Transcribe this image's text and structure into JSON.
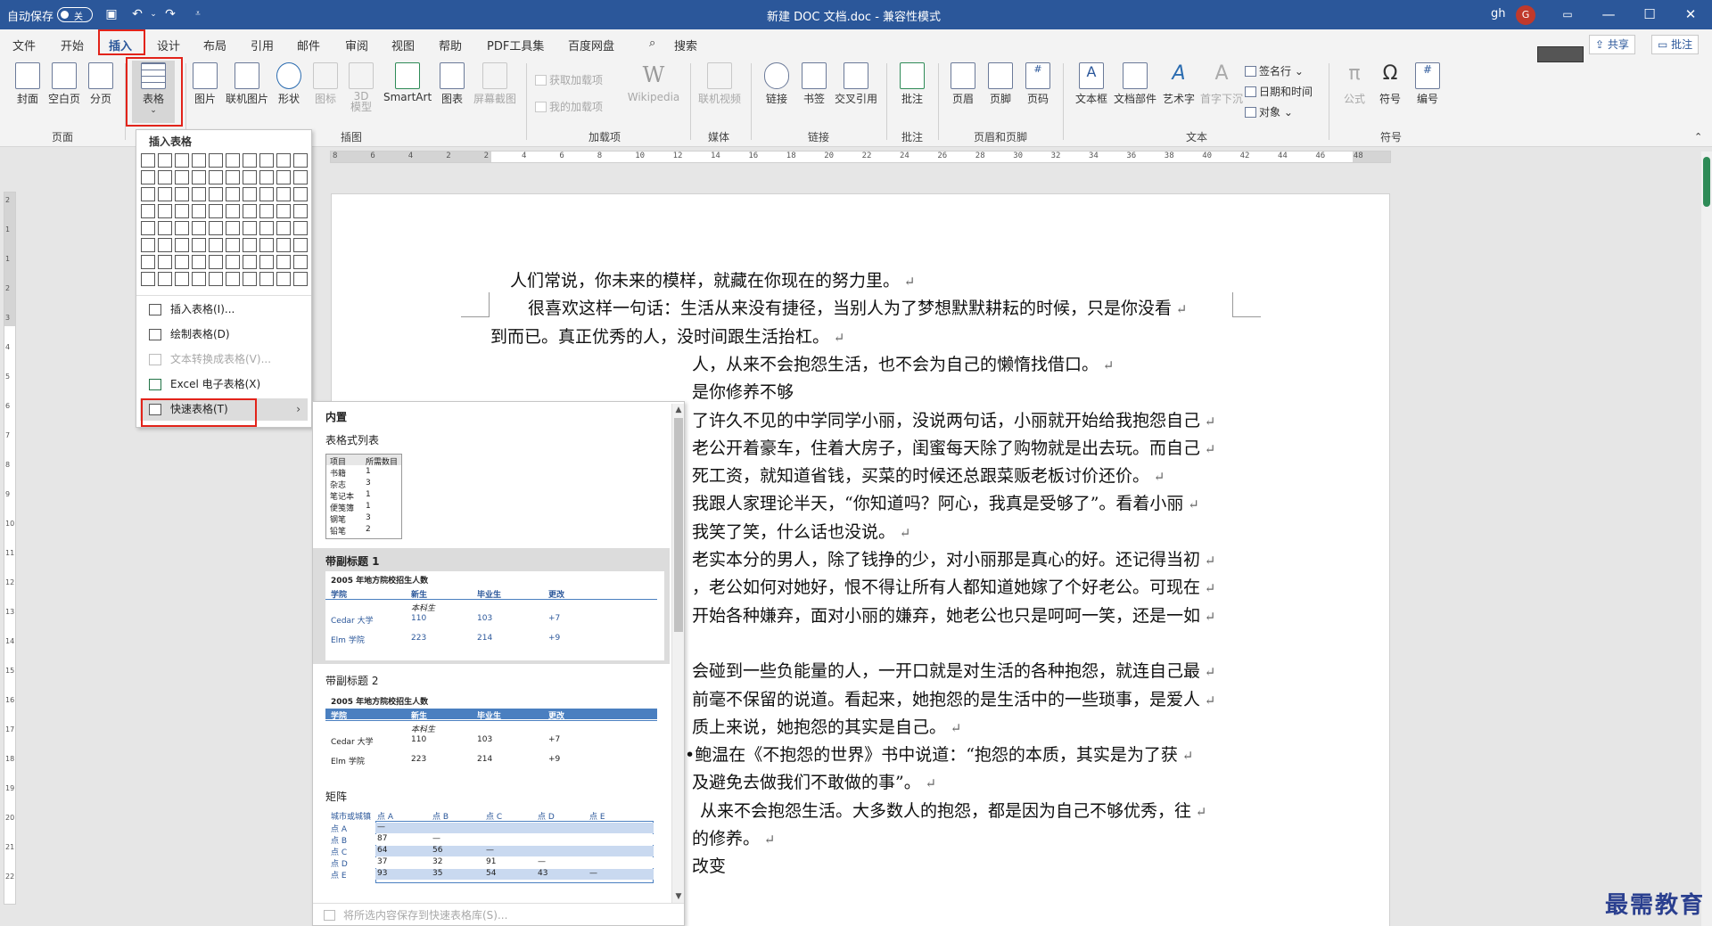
{
  "titlebar": {
    "autosave_label": "自动保存",
    "autosave_state": "关",
    "title": "新建 DOC 文档.doc  -  兼容性模式",
    "user": "gh",
    "avatar_letter": "G"
  },
  "tabs": [
    "文件",
    "开始",
    "插入",
    "设计",
    "布局",
    "引用",
    "邮件",
    "审阅",
    "视图",
    "帮助",
    "PDF工具集",
    "百度网盘"
  ],
  "search_label": "搜索",
  "share_label": "共享",
  "comment_label": "批注",
  "ribbon": {
    "page_group": {
      "label": "页面",
      "buttons": [
        "封面",
        "空白页",
        "分页"
      ]
    },
    "table_btn": "表格",
    "illus_group": {
      "label": "插图",
      "buttons": [
        "图片",
        "联机图片",
        "形状",
        "图标",
        "3D\n模型",
        "SmartArt",
        "图表",
        "屏幕截图"
      ]
    },
    "addins_group": {
      "label": "加载项",
      "get": "获取加载项",
      "my": "我的加载项",
      "wiki": "Wikipedia"
    },
    "media_group": {
      "label": "媒体",
      "video": "联机视频"
    },
    "links_group": {
      "label": "链接",
      "buttons": [
        "链接",
        "书签",
        "交叉引用"
      ]
    },
    "comment_group": {
      "label": "批注",
      "button": "批注"
    },
    "hf_group": {
      "label": "页眉和页脚",
      "buttons": [
        "页眉",
        "页脚",
        "页码"
      ]
    },
    "text_group": {
      "label": "文本",
      "buttons": [
        "文本框",
        "文档部件",
        "艺术字",
        "首字下沉"
      ],
      "small": [
        "签名行",
        "日期和时间",
        "对象"
      ]
    },
    "symbol_group": {
      "label": "符号",
      "buttons": [
        "公式",
        "符号",
        "编号"
      ]
    }
  },
  "ruler_ticks": [
    "8",
    "6",
    "4",
    "2",
    "2",
    "4",
    "6",
    "8",
    "10",
    "12",
    "14",
    "16",
    "18",
    "20",
    "22",
    "24",
    "26",
    "28",
    "30",
    "32",
    "34",
    "36",
    "38",
    "40",
    "42",
    "44",
    "46",
    "48"
  ],
  "vruler_ticks": [
    "2",
    "1",
    "1",
    "2",
    "3",
    "4",
    "5",
    "6",
    "7",
    "8",
    "9",
    "10",
    "11",
    "12",
    "13",
    "14",
    "15",
    "16",
    "17",
    "18",
    "19",
    "20",
    "21",
    "22"
  ],
  "table_menu": {
    "header": "插入表格",
    "items": [
      "插入表格(I)...",
      "绘制表格(D)",
      "文本转换成表格(V)...",
      "Excel 电子表格(X)",
      "快速表格(T)"
    ]
  },
  "gallery": {
    "section": "内置",
    "items": [
      {
        "title": "表格式列表",
        "header": [
          "项目",
          "所需数目"
        ],
        "rows": [
          [
            "书籍",
            "1"
          ],
          [
            "杂志",
            "3"
          ],
          [
            "笔记本",
            "1"
          ],
          [
            "便笺簿",
            "1"
          ],
          [
            "钢笔",
            "3"
          ],
          [
            "铅笔",
            "2"
          ]
        ]
      },
      {
        "title": "带副标题 1",
        "caption": "2005 年地方院校招生人数",
        "header": [
          "学院",
          "新生",
          "毕业生",
          "更改"
        ],
        "sub": "本科生",
        "rows": [
          [
            "Cedar 大学",
            "110",
            "103",
            "+7"
          ],
          [
            "Elm 学院",
            "223",
            "214",
            "+9"
          ]
        ]
      },
      {
        "title": "带副标题 2",
        "caption": "2005 年地方院校招生人数",
        "header": [
          "学院",
          "新生",
          "毕业生",
          "更改"
        ],
        "sub": "本科生",
        "rows": [
          [
            "Cedar 大学",
            "110",
            "103",
            "+7"
          ],
          [
            "Elm 学院",
            "223",
            "214",
            "+9"
          ]
        ]
      },
      {
        "title": "矩阵",
        "header": [
          "城市或城镇",
          "点 A",
          "点 B",
          "点 C",
          "点 D",
          "点 E"
        ],
        "rows": [
          [
            "点 A",
            "—",
            "",
            "",
            "",
            ""
          ],
          [
            "点 B",
            "87",
            "—",
            "",
            "",
            ""
          ],
          [
            "点 C",
            "64",
            "56",
            "—",
            "",
            ""
          ],
          [
            "点 D",
            "37",
            "32",
            "91",
            "—",
            ""
          ],
          [
            "点 E",
            "93",
            "35",
            "54",
            "43",
            "—"
          ]
        ]
      }
    ],
    "footer": "将所选内容保存到快速表格库(S)..."
  },
  "document": {
    "lines": [
      "人们常说，你未来的模样，就藏在你现在的努力里。",
      "很喜欢这样一句话：生活从来没有捷径，当别人为了梦想默默耕耘的时候，只是你没看",
      "到而已。真正优秀的人，没时间跟生活抬杠。",
      "人，从来不会抱怨生活，也不会为自己的懒惰找借口。",
      "是你修养不够",
      "了许久不见的中学同学小丽，没说两句话，小丽就开始给我抱怨自己",
      "老公开着豪车，住着大房子，闺蜜每天除了购物就是出去玩。而自己",
      "死工资，就知道省钱，买菜的时候还总跟菜贩老板讨价还价。",
      "我跟人家理论半天，“你知道吗？阿心，我真是受够了”。看着小丽",
      "我笑了笑，什么话也没说。",
      "老实本分的男人，除了钱挣的少，对小丽那是真心的好。还记得当初",
      "，老公如何对她好，恨不得让所有人都知道她嫁了个好老公。可现在",
      "开始各种嫌弃，面对小丽的嫌弃，她老公也只是呵呵一笑，还是一如",
      "",
      "会碰到一些负能量的人，一开口就是对生活的各种抱怨，就连自己最",
      "前毫不保留的说道。看起来，她抱怨的是生活中的一些琐事，是爱人",
      "质上来说，她抱怨的其实是自己。",
      "•鲍温在《不抱怨的世界》书中说道：“抱怨的本质，其实是为了获",
      "及避免去做我们不敢做的事”。",
      "从来不会抱怨生活。大多数人的抱怨，都是因为自己不够优秀，往",
      "的修养。",
      "改变"
    ]
  },
  "watermark": "最需教育"
}
